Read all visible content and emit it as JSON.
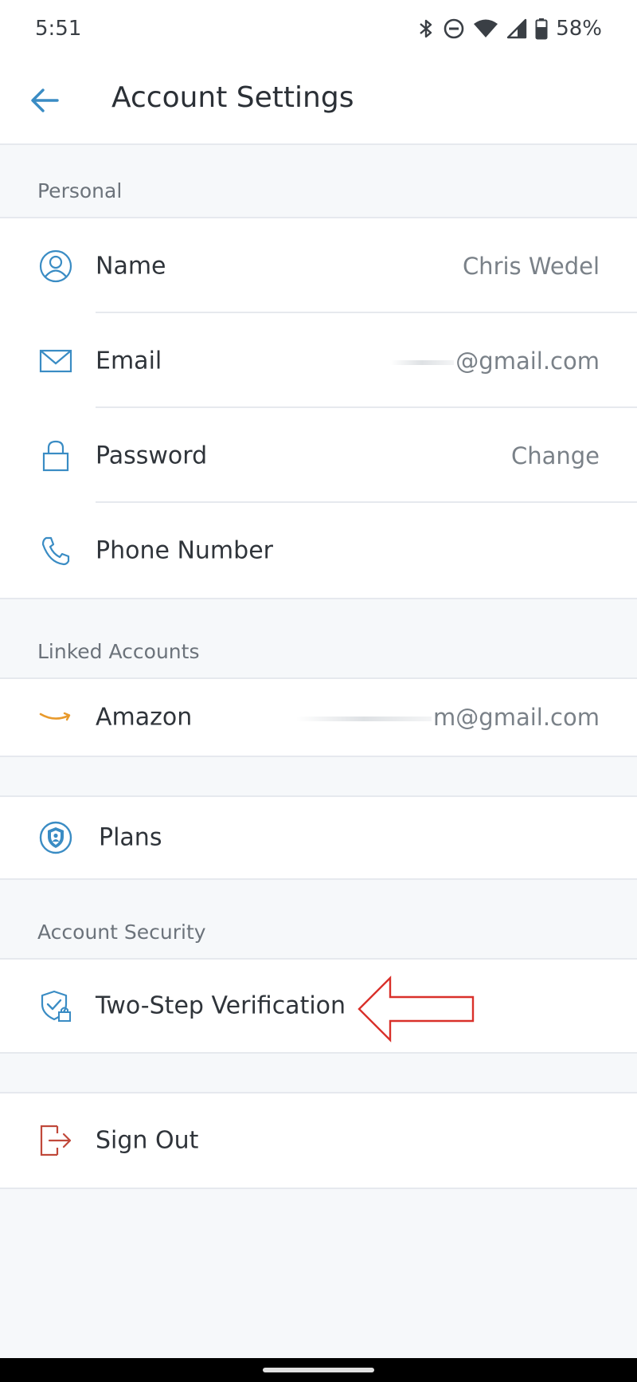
{
  "status_bar": {
    "time": "5:51",
    "battery": "58%",
    "icons": [
      "bluetooth-icon",
      "do-not-disturb-icon",
      "wifi-icon",
      "cellular-icon",
      "battery-icon"
    ]
  },
  "header": {
    "title": "Account Settings",
    "back_icon": "arrow-left-icon"
  },
  "personal": {
    "title": "Personal",
    "items": [
      {
        "label": "Name",
        "value": "Chris Wedel",
        "icon": "person-icon"
      },
      {
        "label": "Email",
        "value": "@gmail.com",
        "icon": "envelope-icon"
      },
      {
        "label": "Password",
        "value": "Change",
        "icon": "lock-icon"
      },
      {
        "label": "Phone Number",
        "value": "",
        "icon": "phone-icon"
      }
    ]
  },
  "linked_accounts": {
    "title": "Linked Accounts",
    "items": [
      {
        "label": "Amazon",
        "value": "m@gmail.com",
        "icon": "amazon-smile-icon"
      }
    ]
  },
  "plans": {
    "label": "Plans",
    "icon": "shield-badge-icon"
  },
  "account_security": {
    "title": "Account Security",
    "items": [
      {
        "label": "Two-Step Verification",
        "icon": "shield-lock-icon"
      }
    ]
  },
  "sign_out": {
    "label": "Sign Out",
    "icon": "sign-out-icon"
  },
  "colors": {
    "accent": "#3a8cc4",
    "amazon": "#e89a2c",
    "sign_out": "#c0483a",
    "annotation": "#d9302a"
  }
}
